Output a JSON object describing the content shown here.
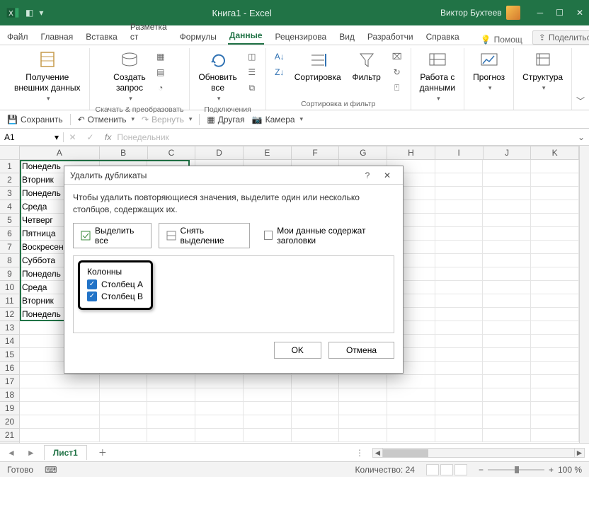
{
  "titlebar": {
    "doc_title": "Книга1 - Excel",
    "user_name": "Виктор Бухтеев"
  },
  "ribbon": {
    "tabs": [
      "Файл",
      "Главная",
      "Вставка",
      "Разметка ст",
      "Формулы",
      "Данные",
      "Рецензирова",
      "Вид",
      "Разработчи",
      "Справка"
    ],
    "help_label": "Помощ",
    "share_label": "Поделиться",
    "groups": {
      "external": {
        "label": "Получение\nвнешних данных",
        "group_label": ""
      },
      "transform": {
        "btn": "Создать\nзапрос",
        "group_label": "Скачать & преобразовать"
      },
      "connections": {
        "btn": "Обновить\nвсе",
        "group_label": "Подключения"
      },
      "sort_filter": {
        "sort": "Сортировка",
        "filter": "Фильтр",
        "group_label": "Сортировка и фильтр"
      },
      "data_tools": {
        "btn": "Работа с\nданными"
      },
      "forecast": {
        "btn": "Прогноз"
      },
      "structure": {
        "btn": "Структура"
      }
    }
  },
  "qat": {
    "save": "Сохранить",
    "undo": "Отменить",
    "redo": "Вернуть",
    "other": "Другая",
    "camera": "Камера"
  },
  "formula_bar": {
    "cell_ref": "A1",
    "fx": "fx",
    "value_preview": "Понедельник"
  },
  "grid": {
    "columns": [
      "A",
      "B",
      "C",
      "D",
      "E",
      "F",
      "G",
      "H",
      "I",
      "J",
      "K"
    ],
    "rows": [
      {
        "n": 1,
        "a": "Понедель"
      },
      {
        "n": 2,
        "a": "Вторник"
      },
      {
        "n": 3,
        "a": "Понедель"
      },
      {
        "n": 4,
        "a": "Среда"
      },
      {
        "n": 5,
        "a": "Четверг"
      },
      {
        "n": 6,
        "a": "Пятница"
      },
      {
        "n": 7,
        "a": "Воскресен"
      },
      {
        "n": 8,
        "a": "Суббота"
      },
      {
        "n": 9,
        "a": "Понедель"
      },
      {
        "n": 10,
        "a": "Среда"
      },
      {
        "n": 11,
        "a": "Вторник"
      },
      {
        "n": 12,
        "a": "Понедель"
      },
      {
        "n": 13,
        "a": ""
      },
      {
        "n": 14,
        "a": ""
      },
      {
        "n": 15,
        "a": ""
      },
      {
        "n": 16,
        "a": ""
      },
      {
        "n": 17,
        "a": ""
      },
      {
        "n": 18,
        "a": ""
      },
      {
        "n": 19,
        "a": ""
      },
      {
        "n": 20,
        "a": ""
      },
      {
        "n": 21,
        "a": ""
      }
    ]
  },
  "dialog": {
    "title": "Удалить дубликаты",
    "message": "Чтобы удалить повторяющиеся значения, выделите один или несколько столбцов, содержащих их.",
    "select_all": "Выделить все",
    "unselect_all": "Снять выделение",
    "headers_check": "Мои данные содержат заголовки",
    "columns_label": "Колонны",
    "columns": [
      "Столбец A",
      "Столбец B"
    ],
    "ok": "OK",
    "cancel": "Отмена"
  },
  "sheet_tabs": {
    "active": "Лист1"
  },
  "status": {
    "ready": "Готово",
    "count": "Количество: 24",
    "zoom": "100 %"
  }
}
